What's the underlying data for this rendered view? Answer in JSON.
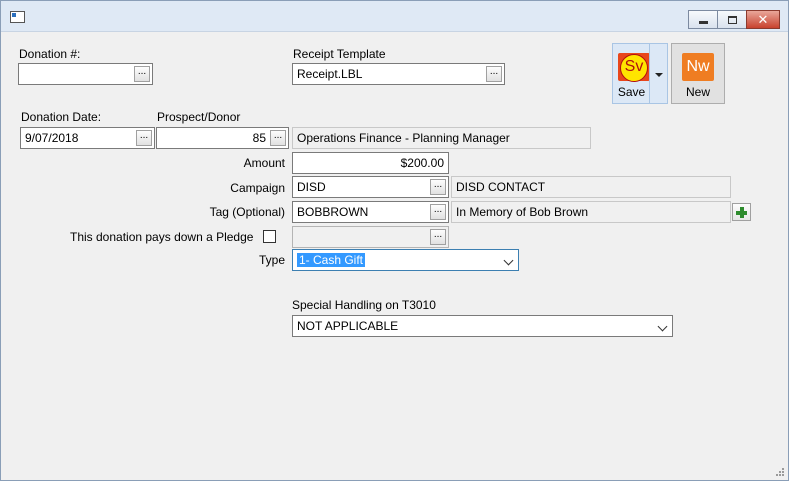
{
  "window": {
    "controls": {
      "minimize": "minimize",
      "maximize": "maximize",
      "close": "close"
    }
  },
  "labels": {
    "donation_no": "Donation #:",
    "receipt_template": "Receipt Template",
    "donation_date": "Donation Date:",
    "prospect_donor": "Prospect/Donor",
    "amount": "Amount",
    "campaign": "Campaign",
    "tag": "Tag (Optional)",
    "pledge": "This donation pays down a Pledge",
    "type": "Type",
    "special_handling": "Special Handling on T3010"
  },
  "fields": {
    "donation_no": "",
    "receipt_template": "Receipt.LBL",
    "donation_date": "9/07/2018",
    "prospect_donor_id": "85",
    "prospect_donor_name": "Operations Finance - Planning Manager",
    "amount": "$200.00",
    "campaign_code": "DISD",
    "campaign_name": "DISD CONTACT",
    "tag_code": "BOBBROWN",
    "tag_name": "In Memory of Bob Brown",
    "pledge_ref": "",
    "type": "1- Cash Gift",
    "special_handling": "NOT APPLICABLE"
  },
  "ellipsis": "...",
  "toolbar": {
    "save_icon_text": "Sv",
    "save_label": "Save",
    "new_icon_text": "Nw",
    "new_label": "New"
  },
  "pledge_checked": false,
  "colors": {
    "accent": "#3399ff",
    "save_icon_bg": "#e8461c",
    "new_icon_bg": "#ef7d22",
    "add_green": "#2e8b2e"
  }
}
